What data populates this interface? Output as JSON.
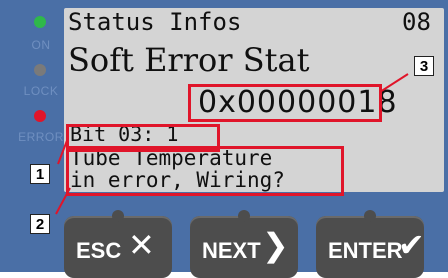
{
  "leds": [
    {
      "label": "ON",
      "color": "#2fb84a"
    },
    {
      "label": "LOCK",
      "color": "#7a7a7a"
    },
    {
      "label": "ERROR",
      "color": "#e0152a"
    }
  ],
  "screen": {
    "header_title": "Status Infos",
    "page_number": "08",
    "main_title": "Soft Error Stat",
    "error_code": "0x00000018",
    "bit_line": "Bit 03: 1",
    "message_line1": "Tube Temperature",
    "message_line2": "in error, Wiring?"
  },
  "callouts": {
    "bit": "1",
    "message": "2",
    "code": "3"
  },
  "keys": {
    "esc": {
      "label": "ESC",
      "glyph": "✕"
    },
    "next": {
      "label": "NEXT",
      "glyph": "❯"
    },
    "enter": {
      "label": "ENTER",
      "glyph": "✔"
    }
  },
  "colors": {
    "highlight": "#e0152a",
    "panel": "#4a6fa6",
    "lcd": "#d4d4d4"
  }
}
